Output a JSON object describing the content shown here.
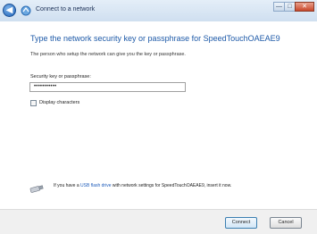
{
  "window": {
    "title": "Connect to a network",
    "caption_buttons": {
      "minimize": "—",
      "maximize": "□",
      "close": "✕"
    }
  },
  "content": {
    "heading": "Type the network security key or passphrase for SpeedTouchOAEAE9",
    "description": "The person who setup the network can give you the key or passphrase.",
    "key_label": "Security key or passphrase:",
    "key_value": "•••••••••••",
    "display_characters_label": "Display characters",
    "display_characters_checked": false,
    "usb_text_before": "If you have a ",
    "usb_link": "USB flash drive",
    "usb_text_after": " with network settings for SpeedTouchOAEAE9, insert it now."
  },
  "buttons": {
    "connect": "Connect",
    "cancel": "Cancel"
  },
  "colors": {
    "heading": "#1e5aa8",
    "link": "#1f5dbb"
  },
  "icons": {
    "back": "back-arrow-icon",
    "network": "network-icon",
    "usb": "usb-drive-icon"
  }
}
